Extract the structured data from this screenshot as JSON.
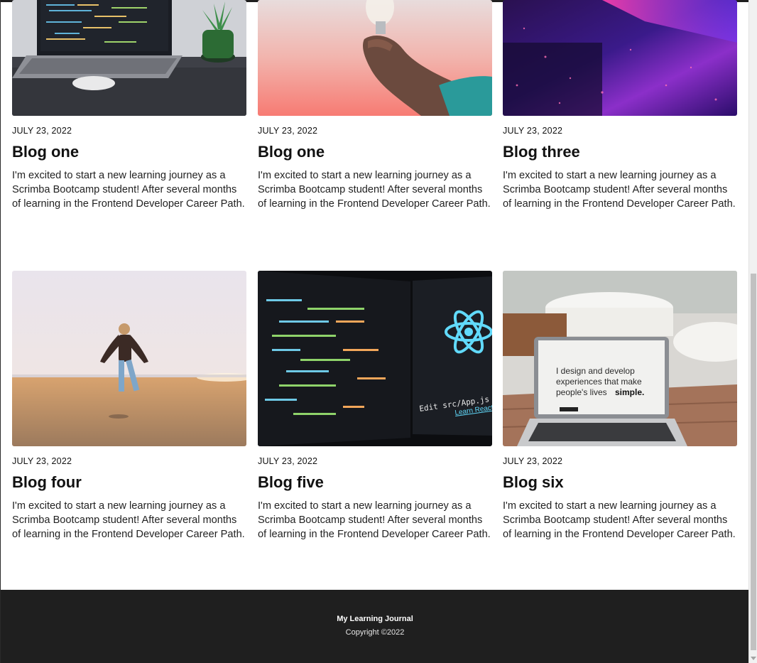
{
  "posts": [
    {
      "date": "JULY 23, 2022",
      "title": "Blog one",
      "excerpt": "I'm excited to start a new learning journey as a Scrimba Bootcamp student! After several months of learning in the Frontend Developer Career Path.",
      "image": "laptop-code-desk-photo"
    },
    {
      "date": "JULY 23, 2022",
      "title": "Blog one",
      "excerpt": "I'm excited to start a new learning journey as a Scrimba Bootcamp student! After several months of learning in the Frontend Developer Career Path.",
      "image": "hand-holding-lightbulb-photo"
    },
    {
      "date": "JULY 23, 2022",
      "title": "Blog three",
      "excerpt": "I'm excited to start a new learning journey as a Scrimba Bootcamp student! After several months of learning in the Frontend Developer Career Path.",
      "image": "purple-neon-rain-photo"
    },
    {
      "date": "JULY 23, 2022",
      "title": "Blog four",
      "excerpt": "I'm excited to start a new learning journey as a Scrimba Bootcamp student! After several months of learning in the Frontend Developer Career Path.",
      "image": "woman-on-beach-photo"
    },
    {
      "date": "JULY 23, 2022",
      "title": "Blog five",
      "excerpt": "I'm excited to start a new learning journey as a Scrimba Bootcamp student! After several months of learning in the Frontend Developer Career Path.",
      "image": "react-code-screen-photo"
    },
    {
      "date": "JULY 23, 2022",
      "title": "Blog six",
      "excerpt": "I'm excited to start a new learning journey as a Scrimba Bootcamp student! After several months of learning in the Frontend Developer Career Path.",
      "image": "laptop-design-quote-photo"
    }
  ],
  "laptop_screen_text": {
    "line1": "I design and develop",
    "line2": "experiences that make",
    "line3": "people's lives",
    "emphasis": "simple."
  },
  "react_screen_text": {
    "edit": "Edit src/App.js and save",
    "link": "Learn React"
  },
  "footer": {
    "title": "My Learning Journal",
    "copyright": "Copyright ©2022"
  }
}
